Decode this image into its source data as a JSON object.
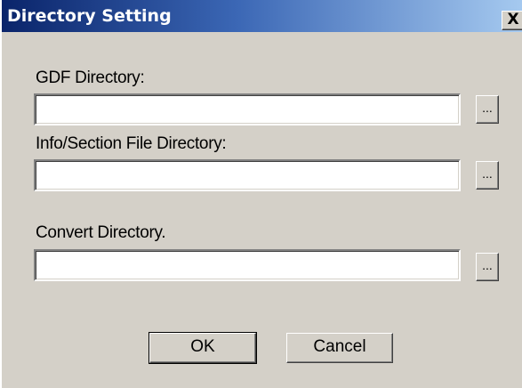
{
  "window": {
    "title": "Directory Setting",
    "close_label": "X"
  },
  "fields": [
    {
      "label": "GDF Directory:",
      "value": "",
      "browse_label": "..."
    },
    {
      "label": "Info/Section File Directory:",
      "value": "",
      "browse_label": "..."
    },
    {
      "label": "Convert Directory.",
      "value": "",
      "browse_label": "..."
    }
  ],
  "buttons": {
    "ok_label": "OK",
    "cancel_label": "Cancel"
  },
  "colors": {
    "dialog_face": "#d4d0c8",
    "titlebar_start": "#0a246a",
    "titlebar_end": "#a6caf0"
  }
}
